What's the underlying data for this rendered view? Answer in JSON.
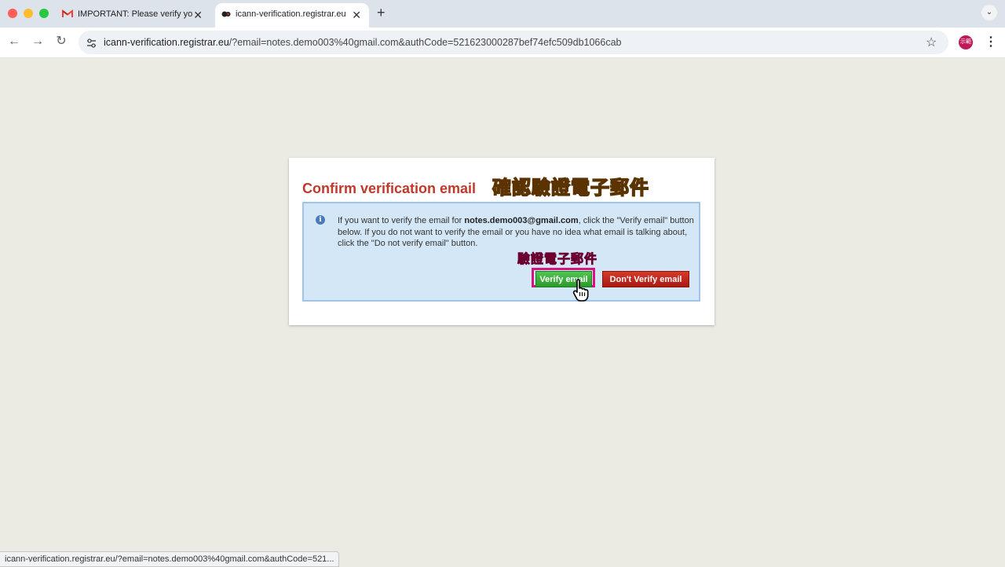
{
  "browser": {
    "tabs": [
      {
        "title": "IMPORTANT: Please verify yo",
        "icon": "gmail-icon",
        "active": false
      },
      {
        "title": "icann-verification.registrar.eu",
        "icon": "site-favicon-icon",
        "active": true
      }
    ],
    "new_tab_label": "+",
    "url_host": "icann-verification.registrar.eu",
    "url_rest": "/?email=notes.demo003%40gmail.com&authCode=521623000287bef74efc509db1066cab",
    "profile_initials": "示範",
    "status_url": "icann-verification.registrar.eu/?email=notes.demo003%40gmail.com&authCode=521..."
  },
  "page": {
    "heading": "Confirm verification email",
    "annotation_title": "確認驗證電子郵件",
    "annotation_button": "驗證電子郵件",
    "info": {
      "text_before": "If you want to verify the email for ",
      "email": "notes.demo003@gmail.com",
      "text_after": ", click the \"Verify email\" button below. If you do not want to verify the email or you have no idea what email is talking about, click the \"Do not verify email\" button."
    },
    "verify_button": "Verify email",
    "dont_verify_button": "Don't Verify email"
  },
  "colors": {
    "heading": "#c0392b",
    "verify": "#2ea82e",
    "dont_verify": "#b3201a",
    "highlight": "#d6137e",
    "annotation_title": "#f7a11a",
    "annotation_button": "#ff2f92"
  }
}
